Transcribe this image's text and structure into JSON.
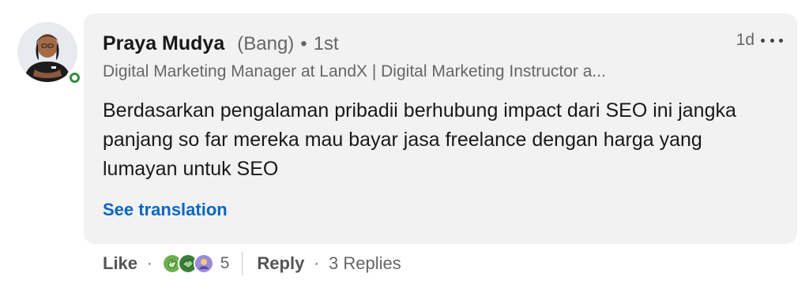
{
  "comment": {
    "author": {
      "name": "Praya Mudya",
      "pronoun": "(Bang)",
      "separator": "•",
      "connection_degree": "1st",
      "headline": "Digital Marketing Manager at LandX | Digital Marketing Instructor a...",
      "online": true,
      "presence_color": "#378a3f"
    },
    "time_ago": "1d",
    "text": "Berdasarkan pengalaman pribadii berhubung impact dari SEO ini jangka panjang so far mereka mau bayar jasa freelance dengan harga yang lumayan untuk SEO",
    "see_translation_label": "See translation",
    "actions": {
      "like_label": "Like",
      "dot": "·",
      "reaction_icons": [
        "clap-reaction-icon",
        "support-reaction-icon",
        "insightful-reaction-icon"
      ],
      "reaction_count": "5",
      "reply_label": "Reply",
      "replies_label": "3 Replies"
    }
  },
  "colors": {
    "bubble_bg": "#f2f2f2",
    "link_blue": "#0a66c2",
    "secondary_text": "#666666"
  }
}
